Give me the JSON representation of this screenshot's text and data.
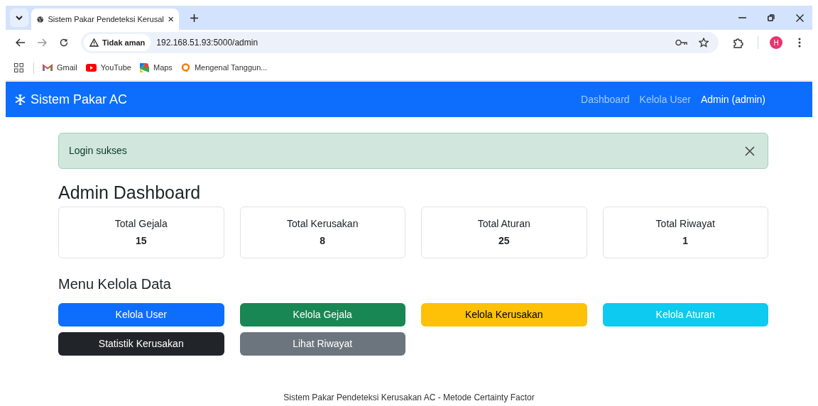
{
  "browser": {
    "tab_title": "Sistem Pakar Pendeteksi Kerusal",
    "address_warning": "Tidak aman",
    "url": "192.168.51.93:5000/admin",
    "profile_initial": "H",
    "bookmarks": [
      {
        "label": "Gmail",
        "kind": "gmail"
      },
      {
        "label": "YouTube",
        "kind": "youtube"
      },
      {
        "label": "Maps",
        "kind": "maps"
      },
      {
        "label": "Mengenal Tanggun...",
        "kind": "site"
      }
    ]
  },
  "navbar": {
    "brand": "Sistem Pakar AC",
    "items": [
      {
        "label": "Dashboard",
        "kind": "link"
      },
      {
        "label": "Kelola User",
        "kind": "link"
      },
      {
        "label": "Admin (admin)",
        "kind": "user"
      }
    ]
  },
  "alert": {
    "message": "Login sukses"
  },
  "title": "Admin Dashboard",
  "stats": [
    {
      "label": "Total Gejala",
      "value": "15"
    },
    {
      "label": "Total Kerusakan",
      "value": "8"
    },
    {
      "label": "Total Aturan",
      "value": "25"
    },
    {
      "label": "Total Riwayat",
      "value": "1"
    }
  ],
  "menu_title": "Menu Kelola Data",
  "menu_buttons": [
    {
      "label": "Kelola User",
      "color": "#0d6efd"
    },
    {
      "label": "Kelola Gejala",
      "color": "#198754"
    },
    {
      "label": "Kelola Kerusakan",
      "color": "#ffc107"
    },
    {
      "label": "Kelola Aturan",
      "color": "#0dcaf0"
    },
    {
      "label": "Statistik Kerusakan",
      "color": "#212529"
    },
    {
      "label": "Lihat Riwayat",
      "color": "#6c757d"
    }
  ],
  "footer": "Sistem Pakar Pendeteksi Kerusakan AC - Metode Certainty Factor"
}
